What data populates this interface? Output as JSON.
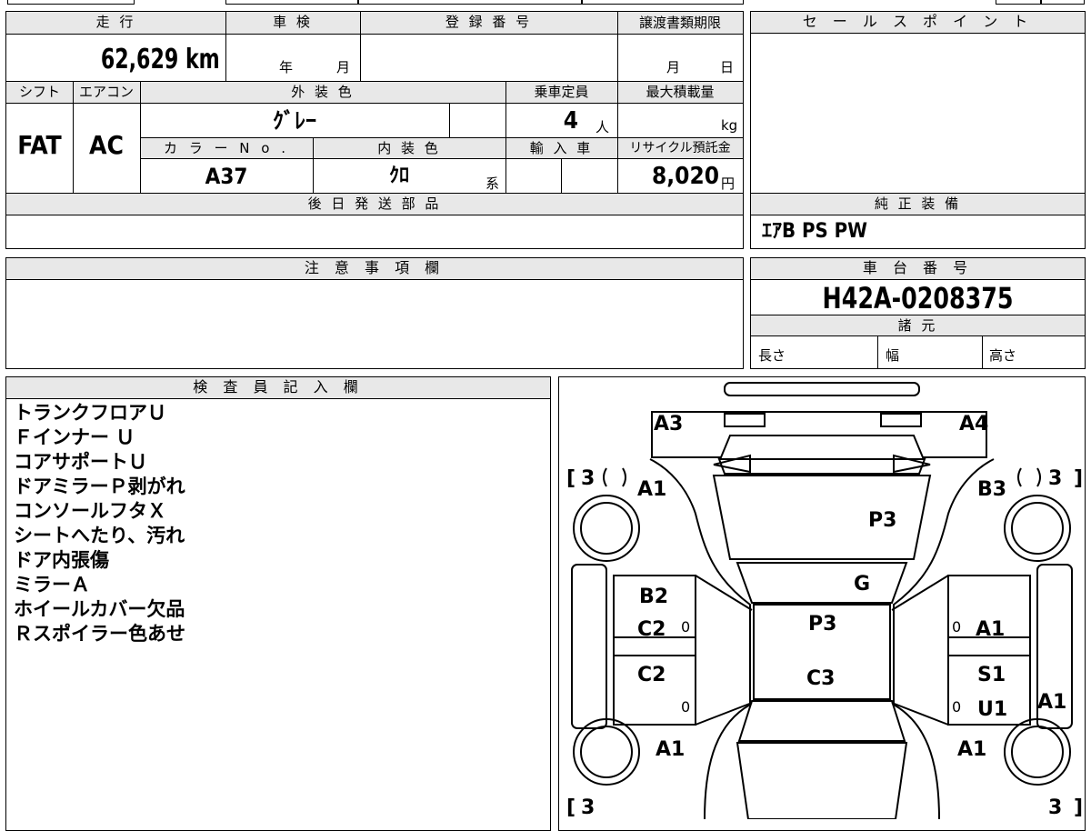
{
  "top_info": {
    "mileage_header": "走 行",
    "mileage_value": "62,629 km",
    "inspection_header": "車 検",
    "inspection_year_label": "年",
    "inspection_month_label": "月",
    "registration_header": "登 録 番 号",
    "registration_value": "",
    "transfer_deadline_header": "譲渡書類期限",
    "transfer_month_label": "月",
    "transfer_day_label": "日",
    "shift_header": "シフト",
    "shift_value": "FAT",
    "ac_header": "エアコン",
    "ac_value": "AC",
    "exterior_color_header": "外 装 色",
    "exterior_color_value": "ｸﾞﾚｰ",
    "capacity_header": "乗車定員",
    "capacity_value": "4",
    "capacity_unit": "人",
    "max_load_header": "最大積載量",
    "max_load_unit": "kg",
    "color_no_header": "カ ラ ー N o .",
    "color_no_value": "A37",
    "interior_color_header": "内 装 色",
    "interior_color_value": "ｸﾛ",
    "interior_color_suffix": "系",
    "import_header": "輸 入 車",
    "recycle_header": "リサイクル預託金",
    "recycle_value": "8,020",
    "recycle_unit": "円"
  },
  "sales_point": {
    "header": "セ ー ル ス ポ イ ン ト",
    "value": ""
  },
  "later_parts": {
    "header": "後 日 発 送 部 品",
    "value": ""
  },
  "genuine_equipment": {
    "header": "純 正 装 備",
    "value": "ｴｱB PS PW"
  },
  "notes": {
    "header": "注 意 事 項 欄",
    "value": ""
  },
  "chassis": {
    "header": "車 台 番 号",
    "value": "H42A-0208375",
    "specs_header": "諸 元",
    "length_label": "長さ",
    "width_label": "幅",
    "height_label": "高さ"
  },
  "inspector": {
    "header": "検 査 員 記 入 欄",
    "lines": [
      "トランクフロアＵ",
      "Ｆインナー Ｕ",
      "コアサポートＵ",
      "ドアミラーＰ剥がれ",
      "コンソールフタＸ",
      "シートへたり、汚れ",
      "ドア内張傷",
      "ミラーＡ",
      "ホイールカバー欠品",
      "Ｒスポイラー色あせ"
    ]
  },
  "diagram": {
    "labels": [
      "A3",
      "A4",
      "A1",
      "B3",
      "P3",
      "G",
      "B2",
      "C2",
      "P3",
      "A1",
      "C2",
      "C3",
      "S1",
      "U1",
      "A1",
      "A1",
      "A1"
    ],
    "bracket_values": [
      "3",
      "3",
      "3",
      "3"
    ],
    "small_zeros": [
      "0",
      "0",
      "0",
      "0"
    ]
  }
}
